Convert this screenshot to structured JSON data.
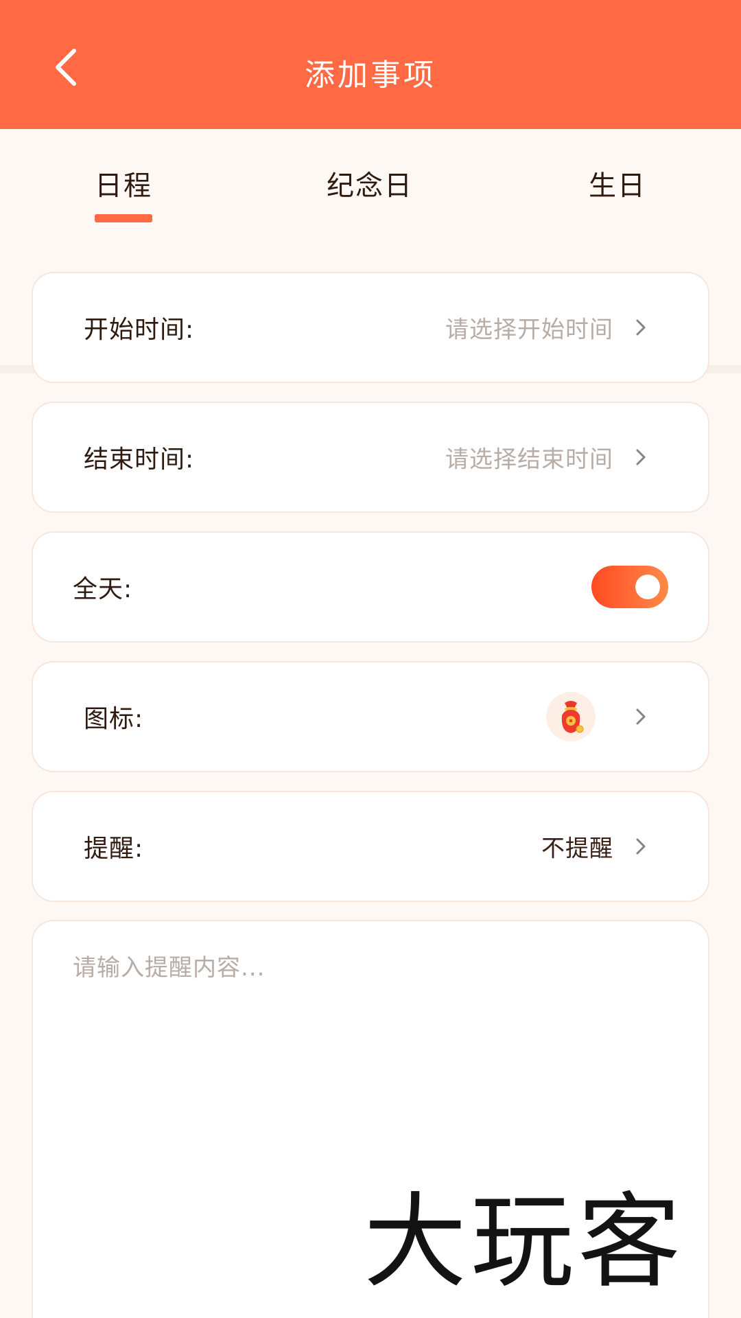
{
  "header": {
    "title": "添加事项",
    "back_icon": "chevron-left-icon",
    "background_color": "#ff6a45"
  },
  "tabs": [
    {
      "label": "日程",
      "active": true
    },
    {
      "label": "纪念日",
      "active": false
    },
    {
      "label": "生日",
      "active": false
    }
  ],
  "form": {
    "start_time": {
      "label": "开始时间:",
      "placeholder": "请选择开始时间"
    },
    "end_time": {
      "label": "结束时间:",
      "placeholder": "请选择结束时间"
    },
    "all_day": {
      "label": "全天:",
      "enabled": true
    },
    "icon": {
      "label": "图标:",
      "selected_icon": "red-money-bag-icon"
    },
    "reminder": {
      "label": "提醒:",
      "value": "不提醒"
    },
    "content": {
      "placeholder": "请输入提醒内容..."
    }
  },
  "watermark": {
    "text": "大玩客"
  },
  "colors": {
    "accent": "#ff6a45",
    "toggle_start": "#ff4a22",
    "toggle_end": "#ff8a4a",
    "placeholder": "#b8aca6",
    "page_background": "#fdf8f4"
  }
}
